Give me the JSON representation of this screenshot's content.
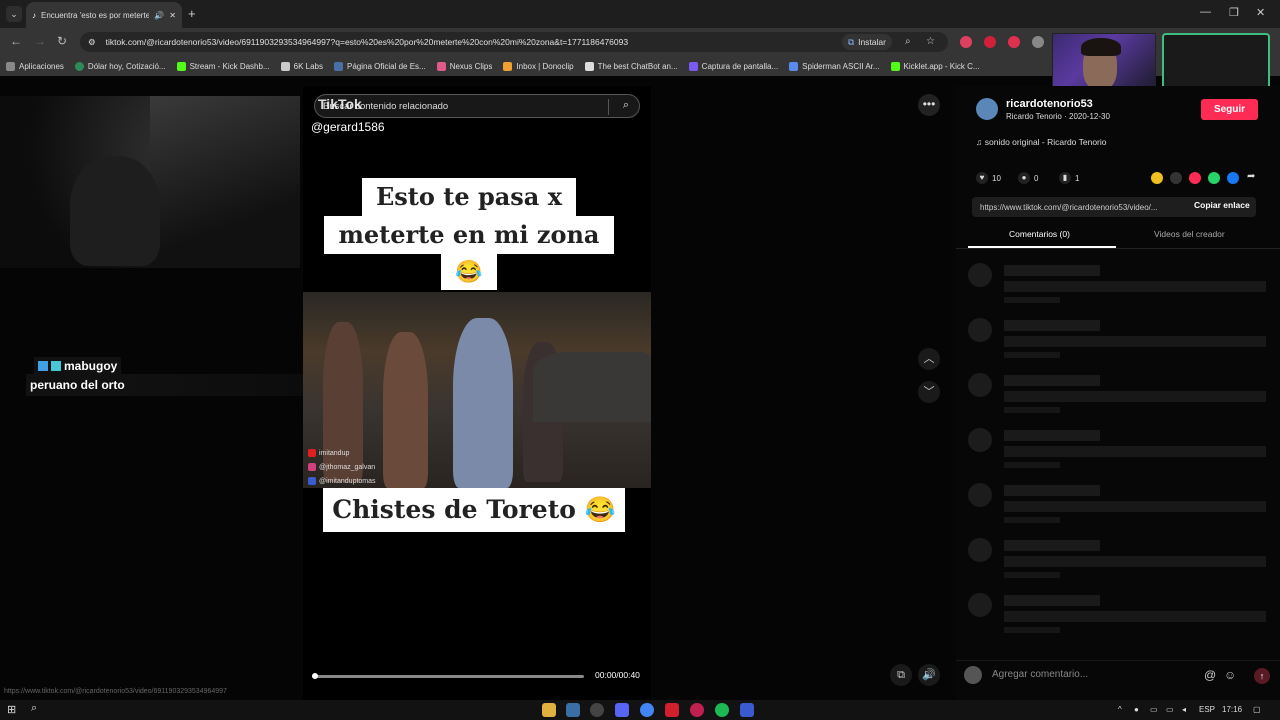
{
  "browser": {
    "tab_title": "Encuentra 'esto es por meterte...",
    "address": "tiktok.com/@ricardotenorio53/video/6911903293534964997?q=esto%20es%20por%20meterte%20con%20mi%20zona&t=1771186476093",
    "install_label": "Instalar",
    "bookmarks": [
      {
        "label": "Aplicaciones",
        "color": "#888888"
      },
      {
        "label": "Dólar hoy, Cotizació...",
        "color": "#2e8b57"
      },
      {
        "label": "Stream - Kick Dashb...",
        "color": "#53fc18"
      },
      {
        "label": "6K Labs",
        "color": "#cccccc"
      },
      {
        "label": "Página Oficial de Es...",
        "color": "#4a6fa5"
      },
      {
        "label": "Nexus Clips",
        "color": "#e05a8a"
      },
      {
        "label": "Inbox | Donoclip",
        "color": "#f0a030"
      },
      {
        "label": "The best ChatBot an...",
        "color": "#dddddd"
      },
      {
        "label": "Captura de pantalla...",
        "color": "#7a5af0"
      },
      {
        "label": "Spiderman ASCII Ar...",
        "color": "#5a8af0"
      },
      {
        "label": "Kicklet.app - Kick C...",
        "color": "#53fc18"
      }
    ]
  },
  "chat": {
    "username": "mabugoy",
    "message": "peruano del orto"
  },
  "video": {
    "search_placeholder": "Buscar contenido relacionado",
    "tiktok_logo": "TikTok",
    "handle": "@gerard1586",
    "caption_line1": "Esto te pasa x",
    "caption_line2": "meterte en mi zona",
    "caption_emoji": "😂",
    "socials": [
      "imitandup",
      "@jthomaz_galvan",
      "@imitanduptomas"
    ],
    "bottom_caption": "Chistes de Toreto 😂",
    "time": "00:00/00:40",
    "progress": 0.0
  },
  "creator": {
    "username": "ricardotenorio53",
    "subtitle": "Ricardo Tenorio · 2020-12-30",
    "follow_label": "Seguir",
    "sound": "sonido original - Ricardo Tenorio",
    "likes": "10",
    "comments": "0",
    "saves": "1",
    "link": "https://www.tiktok.com/@ricardotenorio53/video/...",
    "copy_label": "Copiar enlace",
    "tab_comments": "Comentarios (0)",
    "tab_videos": "Videos del creador",
    "comment_placeholder": "Agregar comentario..."
  },
  "status_url": "https://www.tiktok.com/@ricardotenorio53/video/6911903293534964997",
  "taskbar": {
    "lang": "ESP",
    "time": "17:16"
  }
}
